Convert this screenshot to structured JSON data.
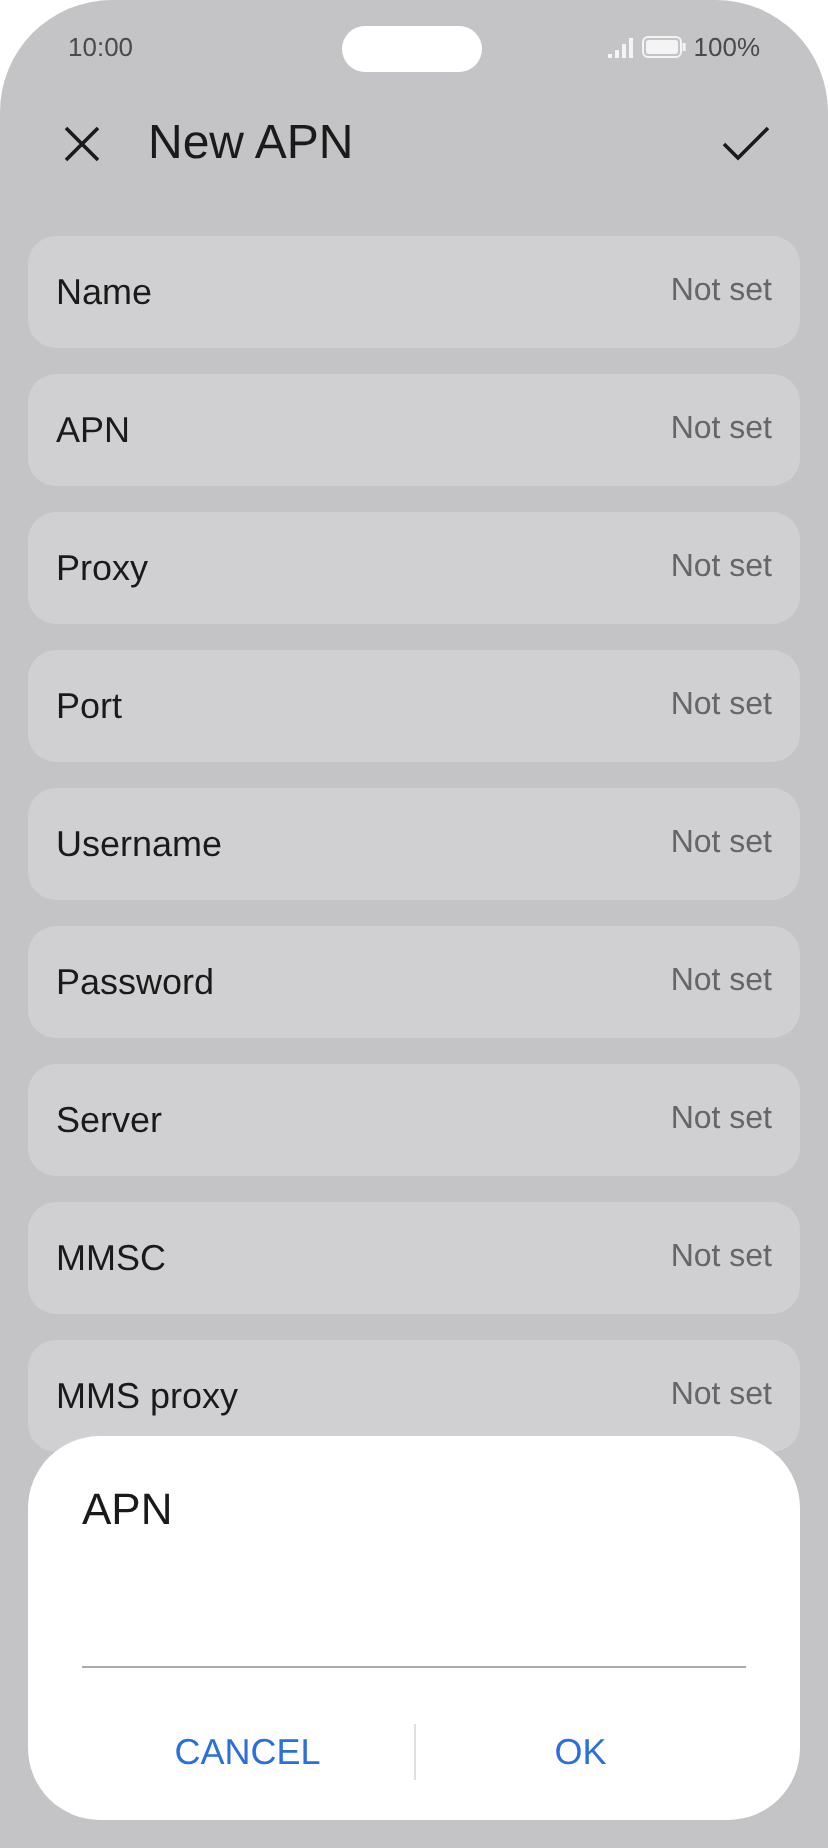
{
  "status_bar": {
    "time": "10:00",
    "battery": "100%"
  },
  "header": {
    "title": "New APN"
  },
  "rows": [
    {
      "label": "Name",
      "value": "Not set"
    },
    {
      "label": "APN",
      "value": "Not set"
    },
    {
      "label": "Proxy",
      "value": "Not set"
    },
    {
      "label": "Port",
      "value": "Not set"
    },
    {
      "label": "Username",
      "value": "Not set"
    },
    {
      "label": "Password",
      "value": "Not set"
    },
    {
      "label": "Server",
      "value": "Not set"
    },
    {
      "label": "MMSC",
      "value": "Not set"
    },
    {
      "label": "MMS proxy",
      "value": "Not set"
    }
  ],
  "dialog": {
    "title": "APN",
    "buttons": [
      "CANCEL",
      "OK"
    ]
  }
}
